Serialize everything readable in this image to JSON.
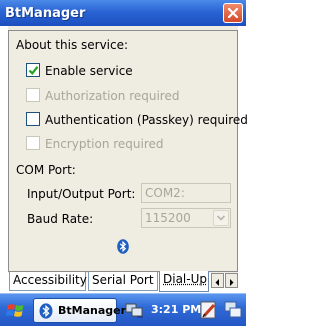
{
  "window": {
    "title": "BtManager"
  },
  "section": {
    "about_label": "About this service:"
  },
  "options": {
    "enable_service": {
      "label": "Enable service",
      "checked": true,
      "enabled": true
    },
    "authorization": {
      "label": "Authorization required",
      "checked": false,
      "enabled": false
    },
    "authentication": {
      "label": "Authentication (Passkey) required",
      "checked": false,
      "enabled": true
    },
    "encryption": {
      "label": "Encryption required",
      "checked": false,
      "enabled": false
    }
  },
  "com": {
    "section_label": "COM Port:",
    "io_port_label": "Input/Output Port:",
    "io_port_value": "COM2:",
    "baud_label": "Baud Rate:",
    "baud_value": "115200"
  },
  "tabs": [
    {
      "label": "Accessibility"
    },
    {
      "label": "Serial Port"
    },
    {
      "label": "Dial-Up",
      "active": true
    }
  ],
  "taskbar": {
    "app_label": "BtManager",
    "clock": "3:21 PM"
  },
  "icons": {
    "close": "close-icon",
    "bluetooth": "bluetooth-icon",
    "start": "windows-flag-icon"
  }
}
